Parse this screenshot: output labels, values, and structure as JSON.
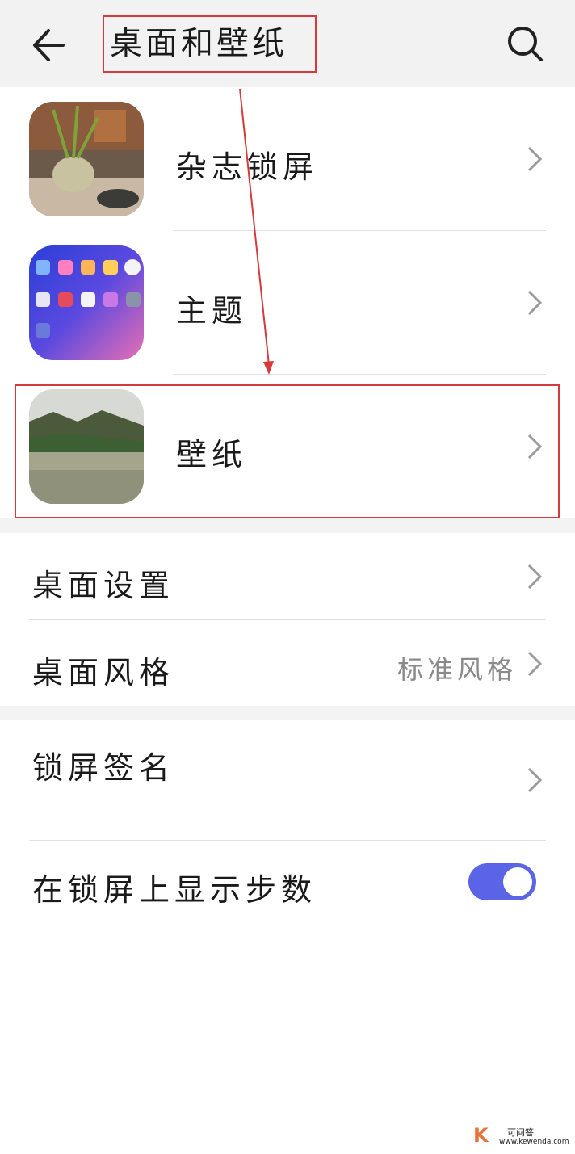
{
  "header": {
    "title": "桌面和壁纸",
    "back_icon": "arrow-left-icon",
    "search_icon": "search-icon"
  },
  "list_top": [
    {
      "label": "杂志锁屏",
      "thumb": "magazine-lockscreen-thumbnail"
    },
    {
      "label": "主题",
      "thumb": "theme-thumbnail"
    },
    {
      "label": "壁纸",
      "thumb": "wallpaper-thumbnail"
    }
  ],
  "desktop": {
    "settings_label": "桌面设置",
    "style_label": "桌面风格",
    "style_value": "标准风格"
  },
  "lockscreen": {
    "signature_label": "锁屏签名",
    "steps_label": "在锁屏上显示步数",
    "steps_toggle_on": true
  },
  "colors": {
    "accent": "#5b63e6",
    "annotation_red": "#d63a3a"
  },
  "watermark": {
    "logo": "K",
    "site_name": "可问答",
    "site_url": "www.kewenda.com"
  }
}
